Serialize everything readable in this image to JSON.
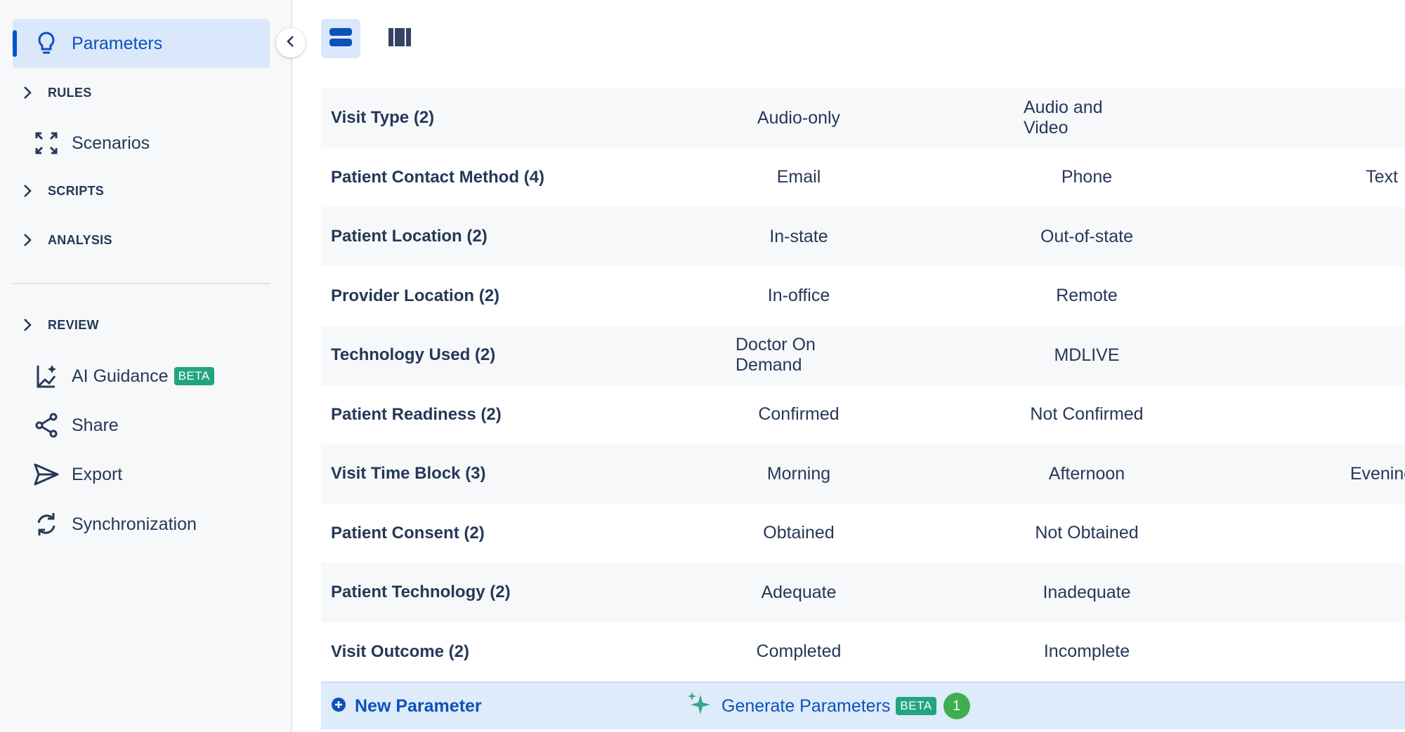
{
  "sidebar": {
    "active_item": {
      "label": "Parameters",
      "icon": "lightbulb-icon"
    },
    "sections": [
      {
        "label": "RULES"
      },
      {
        "label": "SCRIPTS"
      },
      {
        "label": "ANALYSIS"
      },
      {
        "label": "REVIEW"
      }
    ],
    "items": [
      {
        "label": "Scenarios",
        "icon": "expand-arrows-icon"
      },
      {
        "label": "AI Guidance",
        "icon": "ai-guidance-icon",
        "badge": "BETA"
      },
      {
        "label": "Share",
        "icon": "share-icon"
      },
      {
        "label": "Export",
        "icon": "send-icon"
      },
      {
        "label": "Synchronization",
        "icon": "sync-icon"
      }
    ]
  },
  "toolbar": {
    "views": [
      {
        "icon": "list-view-icon",
        "selected": true
      },
      {
        "icon": "column-view-icon",
        "selected": false
      }
    ]
  },
  "parameters": [
    {
      "name": "Visit Type (2)",
      "values": [
        "Audio-only",
        "Audio and Video",
        ""
      ]
    },
    {
      "name": "Patient Contact Method (4)",
      "values": [
        "Email",
        "Phone",
        "Text"
      ]
    },
    {
      "name": "Patient Location (2)",
      "values": [
        "In-state",
        "Out-of-state",
        ""
      ]
    },
    {
      "name": "Provider Location (2)",
      "values": [
        "In-office",
        "Remote",
        ""
      ]
    },
    {
      "name": "Technology Used (2)",
      "values": [
        "Doctor On Demand",
        "MDLIVE",
        ""
      ]
    },
    {
      "name": "Patient Readiness (2)",
      "values": [
        "Confirmed",
        "Not Confirmed",
        ""
      ]
    },
    {
      "name": "Visit Time Block (3)",
      "values": [
        "Morning",
        "Afternoon",
        "Evening"
      ]
    },
    {
      "name": "Patient Consent (2)",
      "values": [
        "Obtained",
        "Not Obtained",
        ""
      ]
    },
    {
      "name": "Patient Technology (2)",
      "values": [
        "Adequate",
        "Inadequate",
        ""
      ]
    },
    {
      "name": "Visit Outcome (2)",
      "values": [
        "Completed",
        "Incomplete",
        ""
      ]
    }
  ],
  "footer": {
    "new_parameter_label": "New Parameter",
    "generate_label": "Generate Parameters",
    "generate_badge": "BETA",
    "generate_count": "1"
  },
  "colors": {
    "accent": "#0c52b8",
    "beta": "#22a57e",
    "count": "#3fae4f"
  }
}
